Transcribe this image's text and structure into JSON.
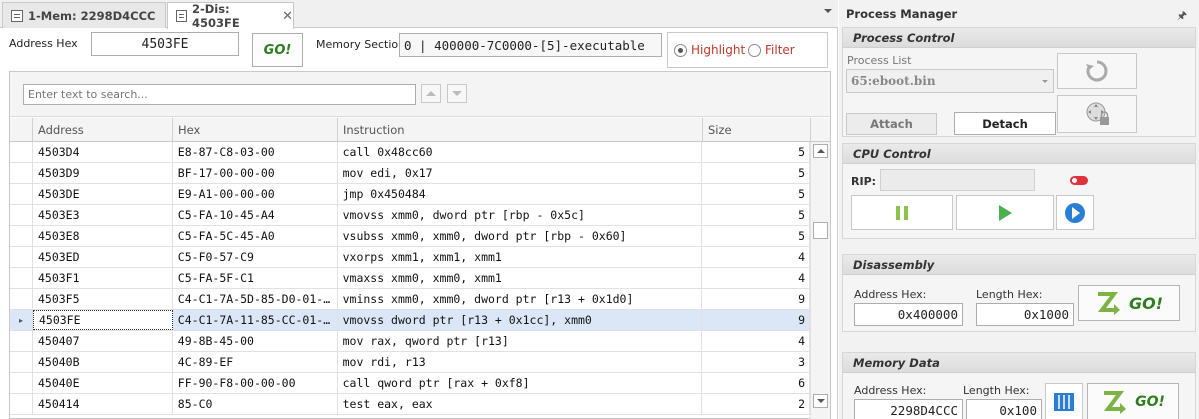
{
  "tabs": [
    {
      "label": "1-Mem: 2298D4CCC",
      "active": false
    },
    {
      "label": "2-Dis: 4503FE",
      "active": true
    }
  ],
  "tab_close": "✕",
  "controls": {
    "address_label": "Address Hex",
    "address_value": "4503FE",
    "go_label": "GO!",
    "section_label": "Memory Section",
    "section_value": "0 | 400000-7C0000-[5]-executable",
    "highlight_label": "Highlight",
    "filter_label": "Filter",
    "highlight_selected": true
  },
  "search": {
    "placeholder": "Enter text to search..."
  },
  "table": {
    "columns": [
      "Address",
      "Hex",
      "Instruction",
      "Size"
    ],
    "rows": [
      {
        "address": "4503D4",
        "hex": "E8-87-C8-03-00",
        "instruction": "call 0x48cc60",
        "size": "5"
      },
      {
        "address": "4503D9",
        "hex": "BF-17-00-00-00",
        "instruction": "mov edi, 0x17",
        "size": "5"
      },
      {
        "address": "4503DE",
        "hex": "E9-A1-00-00-00",
        "instruction": "jmp 0x450484",
        "size": "5"
      },
      {
        "address": "4503E3",
        "hex": "C5-FA-10-45-A4",
        "instruction": "vmovss xmm0, dword ptr [rbp - 0x5c]",
        "size": "5"
      },
      {
        "address": "4503E8",
        "hex": "C5-FA-5C-45-A0",
        "instruction": "vsubss xmm0, xmm0, dword ptr [rbp - 0x60]",
        "size": "5"
      },
      {
        "address": "4503ED",
        "hex": "C5-F0-57-C9",
        "instruction": "vxorps xmm1, xmm1, xmm1",
        "size": "4"
      },
      {
        "address": "4503F1",
        "hex": "C5-FA-5F-C1",
        "instruction": "vmaxss xmm0, xmm0, xmm1",
        "size": "4"
      },
      {
        "address": "4503F5",
        "hex": "C4-C1-7A-5D-85-D0-01-…",
        "instruction": "vminss xmm0, xmm0, dword ptr [r13 + 0x1d0]",
        "size": "9"
      },
      {
        "address": "4503FE",
        "hex": "C4-C1-7A-11-85-CC-01-…",
        "instruction": "vmovss dword ptr [r13 + 0x1cc], xmm0",
        "size": "9",
        "selected": true
      },
      {
        "address": "450407",
        "hex": "49-8B-45-00",
        "instruction": "mov rax, qword ptr [r13]",
        "size": "4"
      },
      {
        "address": "45040B",
        "hex": "4C-89-EF",
        "instruction": "mov rdi, r13",
        "size": "3"
      },
      {
        "address": "45040E",
        "hex": "FF-90-F8-00-00-00",
        "instruction": "call qword ptr [rax + 0xf8]",
        "size": "6"
      },
      {
        "address": "450414",
        "hex": "85-C0",
        "instruction": "test eax, eax",
        "size": "2"
      }
    ]
  },
  "process_manager": {
    "title": "Process Manager",
    "pin_icon": "pin-icon",
    "process_control": {
      "header": "Process Control",
      "list_label": "Process List",
      "selected_process": "65:eboot.bin",
      "attach_label": "Attach",
      "detach_label": "Detach"
    },
    "cpu_control": {
      "header": "CPU Control",
      "rip_label": "RIP:",
      "rip_value": ""
    },
    "disassembly": {
      "header": "Disassembly",
      "address_label": "Address Hex:",
      "length_label": "Length Hex:",
      "address_value": "0x400000",
      "length_value": "0x1000",
      "go_label": "GO!"
    },
    "memory_data": {
      "header": "Memory Data",
      "address_label": "Address Hex:",
      "length_label": "Length Hex:",
      "address_value": "2298D4CCC",
      "length_value": "0x100",
      "go_label": "GO!"
    }
  },
  "colors": {
    "go_green": "#2e7d1f",
    "radio_red": "#c0392b",
    "selection": "#dbe6f7",
    "play_green": "#4caf50",
    "step_blue": "#2a7fd4"
  }
}
